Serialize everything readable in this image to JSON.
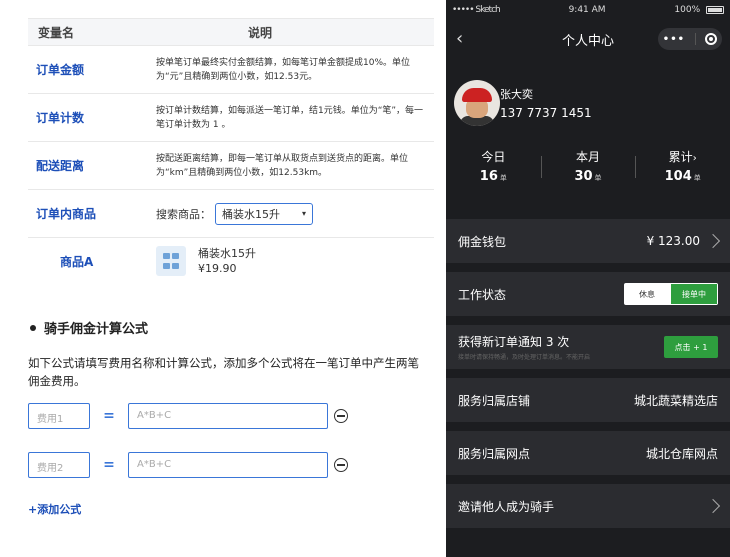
{
  "variables_table": {
    "headers": {
      "name": "变量名",
      "description": "说明"
    },
    "rows": [
      {
        "name": "订单金额",
        "description": "按单笔订单最终实付金额结算，如每笔订单金额提成10%。单位为“元”且精确到两位小数，如12.53元。"
      },
      {
        "name": "订单计数",
        "description": "按订单计数结算，如每派送一笔订单，结1元钱。单位为“笔”，每一笔订单计数为 1 。"
      },
      {
        "name": "配送距离",
        "description": "按配送距离结算，即每一笔订单从取货点到送货点的距离。单位为“km”且精确到两位小数，如12.53km。"
      }
    ],
    "product_row": {
      "name": "订单内商品",
      "search_label": "搜索商品：",
      "selected": "桶装水15升"
    },
    "product": {
      "name": "商品A",
      "title": "桶装水15升",
      "price": "¥19.90"
    }
  },
  "formula": {
    "title": "骑手佣金计算公式",
    "description": "如下公式请填写费用名称和计算公式，添加多个公式将在一笔订单中产生两笔佣金费用。",
    "rows": [
      {
        "name_placeholder": "费用1",
        "equals": "=",
        "expr_placeholder": "A*B+C"
      },
      {
        "name_placeholder": "费用2",
        "equals": "=",
        "expr_placeholder": "A*B+C"
      }
    ],
    "add_label": "+添加公式"
  },
  "phone": {
    "status_bar": {
      "carrier": "••••• Sketch",
      "time": "9:41 AM",
      "battery": "100%"
    },
    "nav": {
      "back": "‹",
      "title": "个人中心",
      "more": "•••"
    },
    "user": {
      "name": "张大奕",
      "phone": "137 7737 1451"
    },
    "stats": [
      {
        "label": "今日",
        "value": "16",
        "unit": "单"
      },
      {
        "label": "本月",
        "value": "30",
        "unit": "单"
      },
      {
        "label": "累计",
        "value": "104",
        "unit": "单"
      }
    ],
    "wallet": {
      "label": "佣金钱包",
      "value": "¥ 123.00"
    },
    "work_status": {
      "label": "工作状态",
      "off": "休息",
      "on": "接单中"
    },
    "notify": {
      "label": "获得新订单通知 3 次",
      "sub": "接单时请保持畅通，及时处理订单消息。不能开启",
      "button": "点击 + 1"
    },
    "store": {
      "label": "服务归属店铺",
      "value": "城北蔬菜精选店"
    },
    "outlet": {
      "label": "服务归属网点",
      "value": "城北仓库网点"
    },
    "invite": {
      "label": "邀请他人成为骑手"
    }
  }
}
